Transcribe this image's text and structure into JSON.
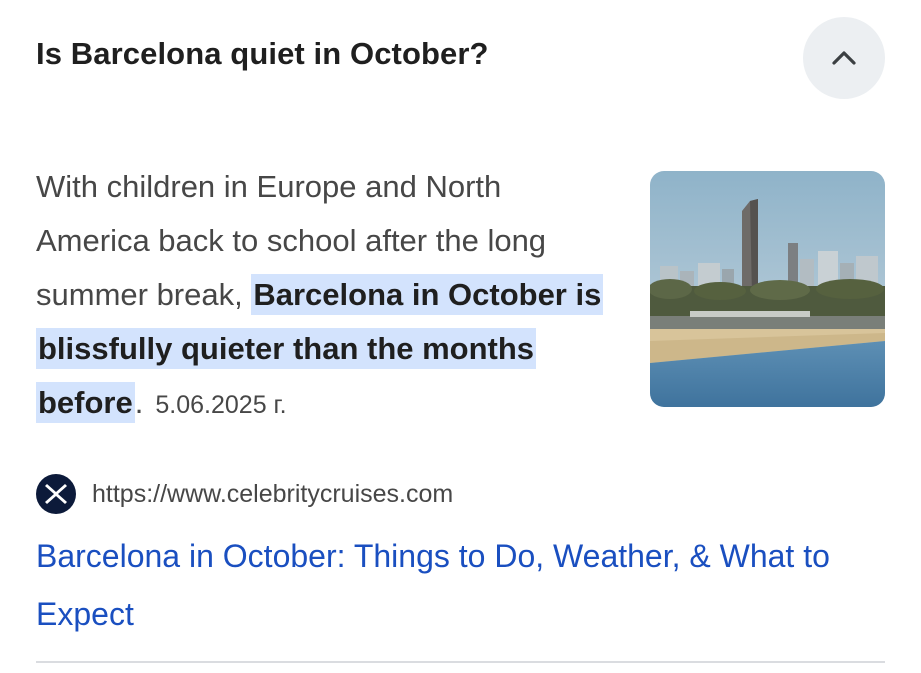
{
  "question": "Is Barcelona quiet in October?",
  "collapse_icon": "chevron-up-icon",
  "answer": {
    "text_before": "With children in Europe and North America back to school after the long summer break, ",
    "highlight": "Barcelona in October is blissfully quieter than the months before",
    "text_after": ".",
    "date": "5.06.2025 г."
  },
  "thumbnail": {
    "subject": "Barcelona beach and skyline"
  },
  "source": {
    "favicon_icon": "celebrity-cruises-x-icon",
    "url": "https://www.celebritycruises.com"
  },
  "result": {
    "title": "Barcelona in October: Things to Do, Weather, & What to Expect"
  },
  "colors": {
    "highlight_bg": "#d3e3fd",
    "link": "#1a4fc0",
    "button_bg": "#eceff2"
  }
}
